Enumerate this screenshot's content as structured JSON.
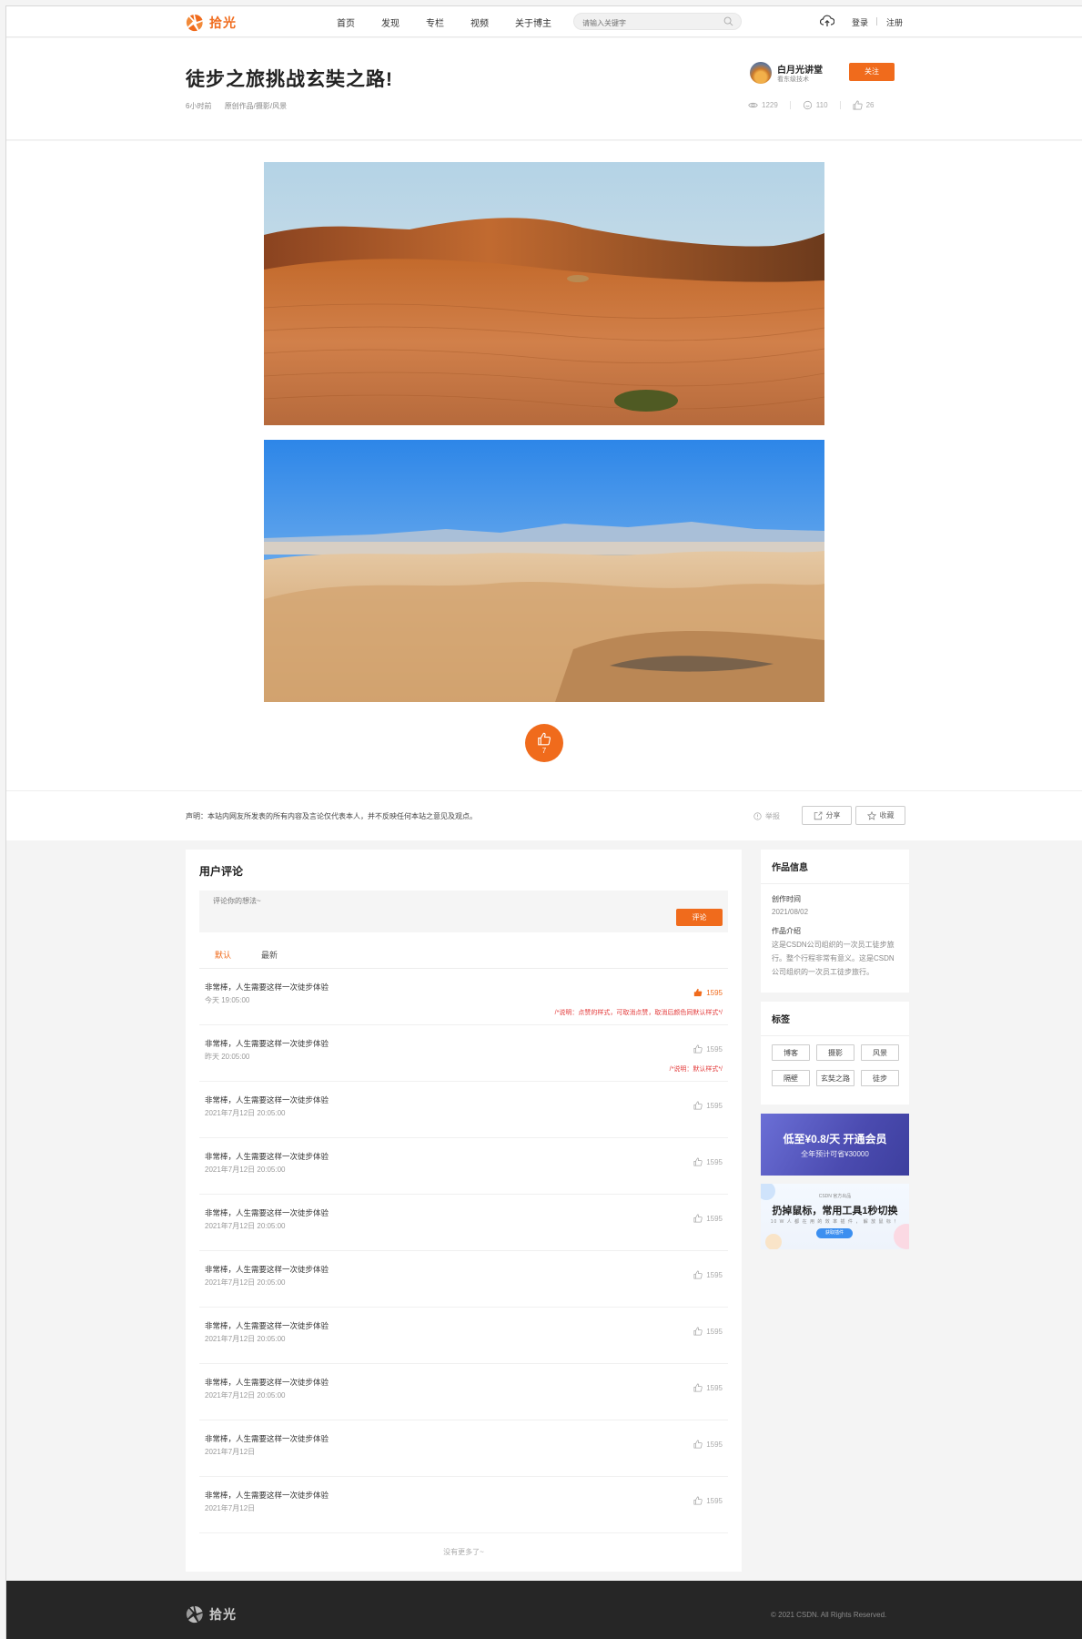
{
  "header": {
    "brand": "拾光",
    "nav": [
      "首页",
      "发现",
      "专栏",
      "视频",
      "关于博主"
    ],
    "search_placeholder": "请输入关键字",
    "login": "登录",
    "register": "注册"
  },
  "article": {
    "title": "徒步之旅挑战玄奘之路!",
    "time": "6小时前",
    "category": "原创作品/摄影/风景",
    "author": {
      "name": "白月光讲堂",
      "subtitle": "看东级技术"
    },
    "follow_label": "关注",
    "stats": {
      "views": "1229",
      "comments": "110",
      "likes": "26"
    },
    "like_button_count": "7"
  },
  "disclaimer": {
    "text": "声明：本站内网友所发表的所有内容及言论仅代表本人，并不反映任何本站之意见及观点。",
    "report": "举报",
    "share": "分享",
    "collect": "收藏"
  },
  "comments": {
    "title": "用户评论",
    "placeholder": "评论你的想法~",
    "submit": "评论",
    "tabs": [
      "默认",
      "最新"
    ],
    "items": [
      {
        "text": "非常棒，人生需要这样一次徒步体验",
        "time": "今天 19:05:00",
        "likes": "1595",
        "liked": true,
        "note": "/*说明：点赞的样式，可取消点赞，取消后颜色同默认样式*/"
      },
      {
        "text": "非常棒，人生需要这样一次徒步体验",
        "time": "昨天 20:05:00",
        "likes": "1595",
        "liked": false,
        "note": "/*说明：默认样式*/"
      },
      {
        "text": "非常棒，人生需要这样一次徒步体验",
        "time": "2021年7月12日 20:05:00",
        "likes": "1595",
        "liked": false,
        "note": ""
      },
      {
        "text": "非常棒，人生需要这样一次徒步体验",
        "time": "2021年7月12日 20:05:00",
        "likes": "1595",
        "liked": false,
        "note": ""
      },
      {
        "text": "非常棒，人生需要这样一次徒步体验",
        "time": "2021年7月12日 20:05:00",
        "likes": "1595",
        "liked": false,
        "note": ""
      },
      {
        "text": "非常棒，人生需要这样一次徒步体验",
        "time": "2021年7月12日 20:05:00",
        "likes": "1595",
        "liked": false,
        "note": ""
      },
      {
        "text": "非常棒，人生需要这样一次徒步体验",
        "time": "2021年7月12日 20:05:00",
        "likes": "1595",
        "liked": false,
        "note": ""
      },
      {
        "text": "非常棒，人生需要这样一次徒步体验",
        "time": "2021年7月12日 20:05:00",
        "likes": "1595",
        "liked": false,
        "note": ""
      },
      {
        "text": "非常棒，人生需要这样一次徒步体验",
        "time": "2021年7月12日",
        "likes": "1595",
        "liked": false,
        "note": ""
      },
      {
        "text": "非常棒，人生需要这样一次徒步体验",
        "time": "2021年7月12日",
        "likes": "1595",
        "liked": false,
        "note": ""
      }
    ],
    "end_text": "没有更多了~"
  },
  "sidebar": {
    "info_title": "作品信息",
    "created_label": "创作时间",
    "created_value": "2021/08/02",
    "intro_label": "作品介绍",
    "intro_value": "这是CSDN公司组织的一次员工徒步旅行。整个行程非常有意义。这是CSDN公司组织的一次员工徒步旅行。",
    "tags_title": "标签",
    "tags": [
      "博客",
      "摄影",
      "风景",
      "隔壁",
      "玄奘之路",
      "徒步"
    ],
    "promo1_title": "低至¥0.8/天 开通会员",
    "promo1_sub": "全年预计可省¥30000",
    "promo2_top": "CSDN 官方出品",
    "promo2_title": "扔掉鼠标，常用工具1秒切换",
    "promo2_sub": "10 W 人 都 在 用 的 效 率 插 件 ， 解 放 鼠 标 ！",
    "promo2_btn": "获取插件"
  },
  "footer": {
    "brand": "拾光",
    "copyright": "© 2021 CSDN. All Rights Reserved."
  },
  "colors": {
    "accent": "#f06b1c",
    "footer_bg": "#262626"
  }
}
